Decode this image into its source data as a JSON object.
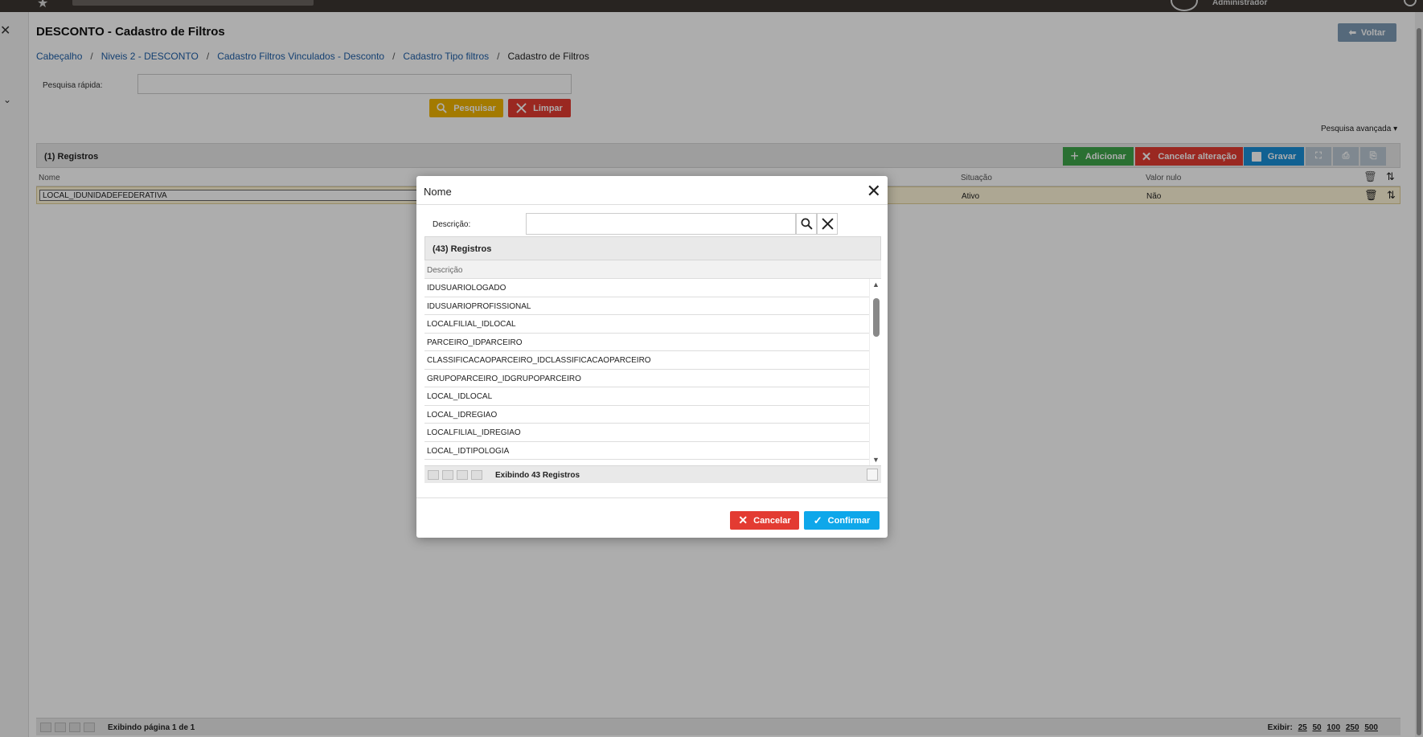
{
  "topbar": {
    "user": "Administrador"
  },
  "page": {
    "title": "DESCONTO - Cadastro de Filtros",
    "back_label": "Voltar"
  },
  "breadcrumbs": [
    {
      "label": "Cabeçalho"
    },
    {
      "label": "Niveis 2 - DESCONTO"
    },
    {
      "label": "Cadastro Filtros Vinculados - Desconto"
    },
    {
      "label": "Cadastro Tipo filtros"
    },
    {
      "label": "Cadastro de Filtros"
    }
  ],
  "search": {
    "label": "Pesquisa rápida:",
    "value": "",
    "search_label": "Pesquisar",
    "clear_label": "Limpar",
    "advanced_label": "Pesquisa avançada"
  },
  "grid": {
    "count": "(1) Registros",
    "add_label": "Adicionar",
    "cancel_label": "Cancelar alteração",
    "save_label": "Gravar",
    "columns": [
      "Nome",
      "Situação",
      "Valor nulo"
    ],
    "row": {
      "nome": "LOCAL_IDUNIDADEFEDERATIVA",
      "situacao": "Ativo",
      "valor_nulo": "Não"
    },
    "footer": {
      "page_text": "Exibindo página 1 de 1",
      "show_label": "Exibir:",
      "sizes": [
        "25",
        "50",
        "100",
        "250",
        "500"
      ]
    }
  },
  "modal": {
    "title": "Nome",
    "desc_label": "Descrição:",
    "desc_value": "",
    "count": "(43) Registros",
    "column": "Descrição",
    "items": [
      "IDUSUARIOLOGADO",
      "IDUSUARIOPROFISSIONAL",
      "LOCALFILIAL_IDLOCAL",
      "PARCEIRO_IDPARCEIRO",
      "CLASSIFICACAOPARCEIRO_IDCLASSIFICACAOPARCEIRO",
      "GRUPOPARCEIRO_IDGRUPOPARCEIRO",
      "LOCAL_IDLOCAL",
      "LOCAL_IDREGIAO",
      "LOCALFILIAL_IDREGIAO",
      "LOCAL_IDTIPOLOGIA"
    ],
    "footer_text": "Exibindo 43 Registros",
    "cancel_label": "Cancelar",
    "confirm_label": "Confirmar"
  }
}
